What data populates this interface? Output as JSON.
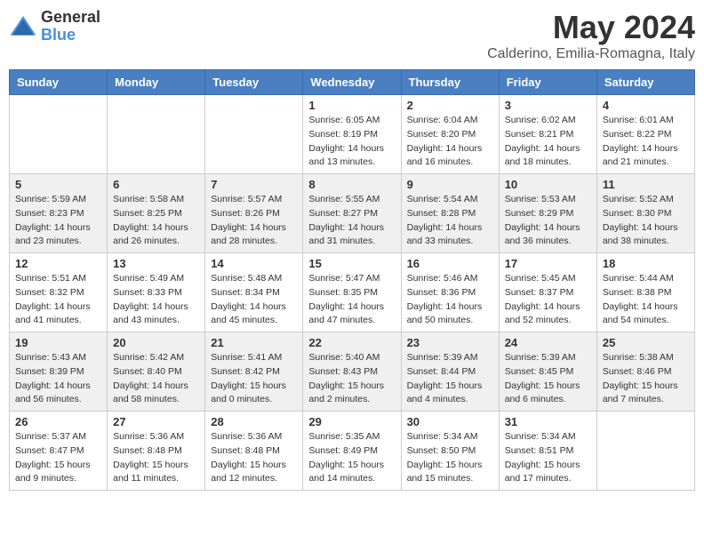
{
  "header": {
    "logo_general": "General",
    "logo_blue": "Blue",
    "month": "May 2024",
    "location": "Calderino, Emilia-Romagna, Italy"
  },
  "weekdays": [
    "Sunday",
    "Monday",
    "Tuesday",
    "Wednesday",
    "Thursday",
    "Friday",
    "Saturday"
  ],
  "weeks": [
    [
      {
        "day": "",
        "info": ""
      },
      {
        "day": "",
        "info": ""
      },
      {
        "day": "",
        "info": ""
      },
      {
        "day": "1",
        "info": "Sunrise: 6:05 AM\nSunset: 8:19 PM\nDaylight: 14 hours\nand 13 minutes."
      },
      {
        "day": "2",
        "info": "Sunrise: 6:04 AM\nSunset: 8:20 PM\nDaylight: 14 hours\nand 16 minutes."
      },
      {
        "day": "3",
        "info": "Sunrise: 6:02 AM\nSunset: 8:21 PM\nDaylight: 14 hours\nand 18 minutes."
      },
      {
        "day": "4",
        "info": "Sunrise: 6:01 AM\nSunset: 8:22 PM\nDaylight: 14 hours\nand 21 minutes."
      }
    ],
    [
      {
        "day": "5",
        "info": "Sunrise: 5:59 AM\nSunset: 8:23 PM\nDaylight: 14 hours\nand 23 minutes."
      },
      {
        "day": "6",
        "info": "Sunrise: 5:58 AM\nSunset: 8:25 PM\nDaylight: 14 hours\nand 26 minutes."
      },
      {
        "day": "7",
        "info": "Sunrise: 5:57 AM\nSunset: 8:26 PM\nDaylight: 14 hours\nand 28 minutes."
      },
      {
        "day": "8",
        "info": "Sunrise: 5:55 AM\nSunset: 8:27 PM\nDaylight: 14 hours\nand 31 minutes."
      },
      {
        "day": "9",
        "info": "Sunrise: 5:54 AM\nSunset: 8:28 PM\nDaylight: 14 hours\nand 33 minutes."
      },
      {
        "day": "10",
        "info": "Sunrise: 5:53 AM\nSunset: 8:29 PM\nDaylight: 14 hours\nand 36 minutes."
      },
      {
        "day": "11",
        "info": "Sunrise: 5:52 AM\nSunset: 8:30 PM\nDaylight: 14 hours\nand 38 minutes."
      }
    ],
    [
      {
        "day": "12",
        "info": "Sunrise: 5:51 AM\nSunset: 8:32 PM\nDaylight: 14 hours\nand 41 minutes."
      },
      {
        "day": "13",
        "info": "Sunrise: 5:49 AM\nSunset: 8:33 PM\nDaylight: 14 hours\nand 43 minutes."
      },
      {
        "day": "14",
        "info": "Sunrise: 5:48 AM\nSunset: 8:34 PM\nDaylight: 14 hours\nand 45 minutes."
      },
      {
        "day": "15",
        "info": "Sunrise: 5:47 AM\nSunset: 8:35 PM\nDaylight: 14 hours\nand 47 minutes."
      },
      {
        "day": "16",
        "info": "Sunrise: 5:46 AM\nSunset: 8:36 PM\nDaylight: 14 hours\nand 50 minutes."
      },
      {
        "day": "17",
        "info": "Sunrise: 5:45 AM\nSunset: 8:37 PM\nDaylight: 14 hours\nand 52 minutes."
      },
      {
        "day": "18",
        "info": "Sunrise: 5:44 AM\nSunset: 8:38 PM\nDaylight: 14 hours\nand 54 minutes."
      }
    ],
    [
      {
        "day": "19",
        "info": "Sunrise: 5:43 AM\nSunset: 8:39 PM\nDaylight: 14 hours\nand 56 minutes."
      },
      {
        "day": "20",
        "info": "Sunrise: 5:42 AM\nSunset: 8:40 PM\nDaylight: 14 hours\nand 58 minutes."
      },
      {
        "day": "21",
        "info": "Sunrise: 5:41 AM\nSunset: 8:42 PM\nDaylight: 15 hours\nand 0 minutes."
      },
      {
        "day": "22",
        "info": "Sunrise: 5:40 AM\nSunset: 8:43 PM\nDaylight: 15 hours\nand 2 minutes."
      },
      {
        "day": "23",
        "info": "Sunrise: 5:39 AM\nSunset: 8:44 PM\nDaylight: 15 hours\nand 4 minutes."
      },
      {
        "day": "24",
        "info": "Sunrise: 5:39 AM\nSunset: 8:45 PM\nDaylight: 15 hours\nand 6 minutes."
      },
      {
        "day": "25",
        "info": "Sunrise: 5:38 AM\nSunset: 8:46 PM\nDaylight: 15 hours\nand 7 minutes."
      }
    ],
    [
      {
        "day": "26",
        "info": "Sunrise: 5:37 AM\nSunset: 8:47 PM\nDaylight: 15 hours\nand 9 minutes."
      },
      {
        "day": "27",
        "info": "Sunrise: 5:36 AM\nSunset: 8:48 PM\nDaylight: 15 hours\nand 11 minutes."
      },
      {
        "day": "28",
        "info": "Sunrise: 5:36 AM\nSunset: 8:48 PM\nDaylight: 15 hours\nand 12 minutes."
      },
      {
        "day": "29",
        "info": "Sunrise: 5:35 AM\nSunset: 8:49 PM\nDaylight: 15 hours\nand 14 minutes."
      },
      {
        "day": "30",
        "info": "Sunrise: 5:34 AM\nSunset: 8:50 PM\nDaylight: 15 hours\nand 15 minutes."
      },
      {
        "day": "31",
        "info": "Sunrise: 5:34 AM\nSunset: 8:51 PM\nDaylight: 15 hours\nand 17 minutes."
      },
      {
        "day": "",
        "info": ""
      }
    ]
  ]
}
